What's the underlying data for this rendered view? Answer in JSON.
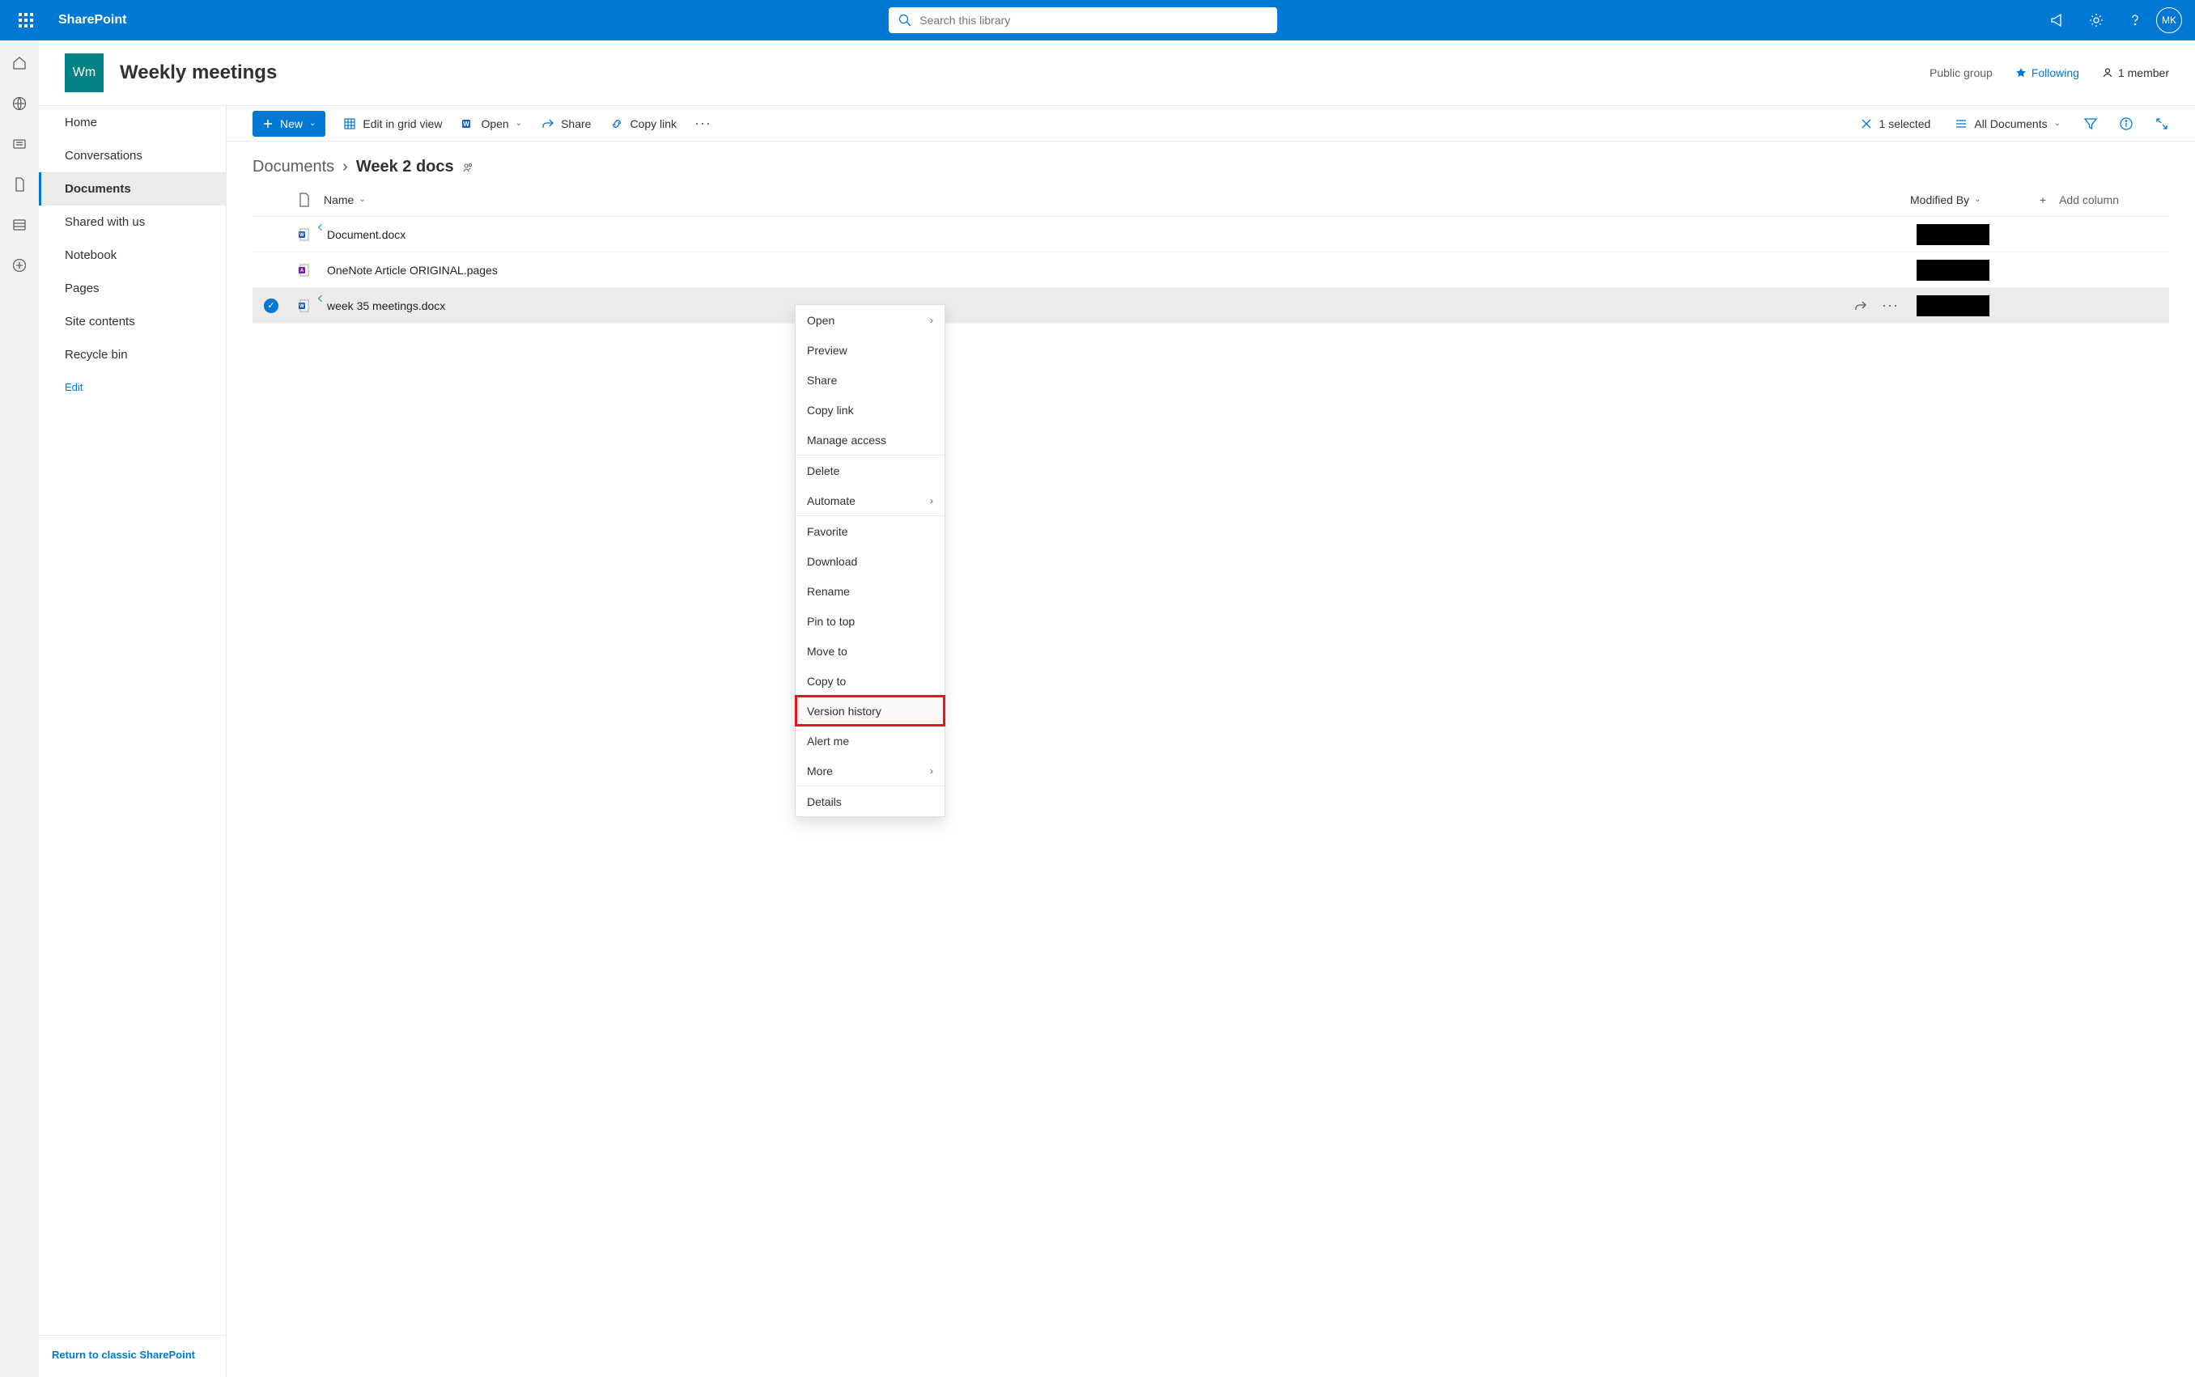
{
  "brand": "SharePoint",
  "search": {
    "placeholder": "Search this library"
  },
  "avatar_initials": "MK",
  "site": {
    "logo_text": "Wm",
    "title": "Weekly meetings",
    "group_type": "Public group",
    "follow_label": "Following",
    "members_label": "1 member"
  },
  "nav": {
    "items": [
      {
        "label": "Home"
      },
      {
        "label": "Conversations"
      },
      {
        "label": "Documents",
        "active": true
      },
      {
        "label": "Shared with us"
      },
      {
        "label": "Notebook"
      },
      {
        "label": "Pages"
      },
      {
        "label": "Site contents"
      },
      {
        "label": "Recycle bin"
      }
    ],
    "edit_label": "Edit",
    "return_label": "Return to classic SharePoint"
  },
  "cmdbar": {
    "new_label": "New",
    "edit_grid_label": "Edit in grid view",
    "open_label": "Open",
    "share_label": "Share",
    "copy_link_label": "Copy link",
    "selected_label": "1 selected",
    "view_label": "All Documents"
  },
  "breadcrumb": {
    "root": "Documents",
    "current": "Week 2 docs"
  },
  "table": {
    "name_header": "Name",
    "modifiedby_header": "Modified By",
    "addcol_label": "Add column",
    "rows": [
      {
        "name": "Document.docx",
        "type": "docx",
        "new": true
      },
      {
        "name": "OneNote Article ORIGINAL.pages",
        "type": "pages",
        "new": false
      },
      {
        "name": "week 35 meetings.docx",
        "type": "docx",
        "new": true,
        "selected": true
      }
    ]
  },
  "context_menu": {
    "items": [
      {
        "label": "Open",
        "chev": true
      },
      {
        "label": "Preview"
      },
      {
        "label": "Share"
      },
      {
        "label": "Copy link"
      },
      {
        "label": "Manage access",
        "sep_after": true
      },
      {
        "label": "Delete"
      },
      {
        "label": "Automate",
        "chev": true,
        "sep_after": true
      },
      {
        "label": "Favorite"
      },
      {
        "label": "Download"
      },
      {
        "label": "Rename"
      },
      {
        "label": "Pin to top"
      },
      {
        "label": "Move to"
      },
      {
        "label": "Copy to"
      },
      {
        "label": "Version history",
        "highlight": true
      },
      {
        "label": "Alert me"
      },
      {
        "label": "More",
        "chev": true,
        "sep_after": true
      },
      {
        "label": "Details"
      }
    ]
  }
}
